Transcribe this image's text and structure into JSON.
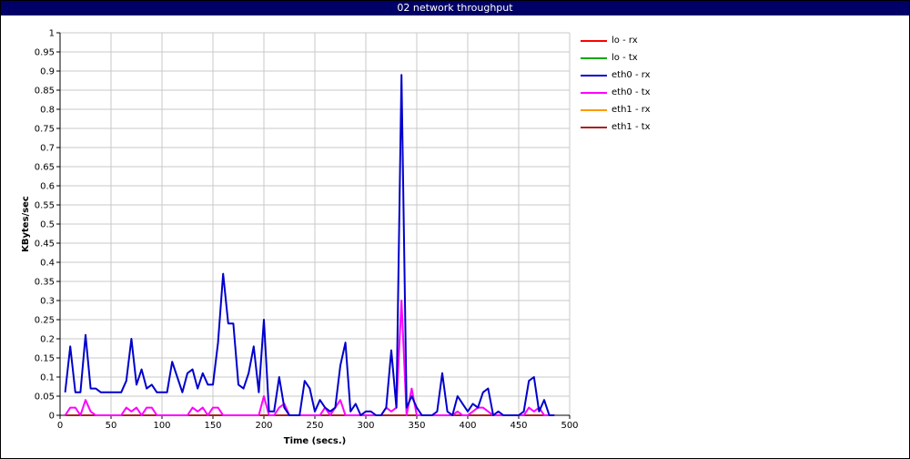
{
  "title": "02 network throughput",
  "chart_data": {
    "type": "line",
    "title": "02 network throughput",
    "xlabel": "Time (secs.)",
    "ylabel": "KBytes/sec",
    "xlim": [
      0,
      500
    ],
    "ylim": [
      0,
      1
    ],
    "xticks": [
      "0",
      "50",
      "100",
      "150",
      "200",
      "250",
      "300",
      "350",
      "400",
      "450",
      "500"
    ],
    "yticks": [
      "0",
      "0.05",
      "0.1",
      "0.15",
      "0.2",
      "0.25",
      "0.3",
      "0.35",
      "0.4",
      "0.45",
      "0.5",
      "0.55",
      "0.6",
      "0.65",
      "0.7",
      "0.75",
      "0.8",
      "0.85",
      "0.9",
      "0.95",
      "1"
    ],
    "grid": true,
    "legend_position": "right",
    "series": [
      {
        "name": "lo - rx",
        "color": "#ff0000",
        "x": [
          5,
          485
        ],
        "y": [
          0,
          0
        ]
      },
      {
        "name": "lo - tx",
        "color": "#00aa00",
        "x": [
          5,
          485
        ],
        "y": [
          0,
          0
        ]
      },
      {
        "name": "eth0 - rx",
        "color": "#0000cc",
        "x": [
          5,
          10,
          15,
          20,
          25,
          30,
          35,
          40,
          45,
          50,
          55,
          60,
          65,
          70,
          75,
          80,
          85,
          90,
          95,
          100,
          105,
          110,
          115,
          120,
          125,
          130,
          135,
          140,
          145,
          150,
          155,
          160,
          165,
          170,
          175,
          180,
          185,
          190,
          195,
          200,
          205,
          210,
          215,
          220,
          225,
          230,
          235,
          240,
          245,
          250,
          255,
          260,
          265,
          270,
          275,
          280,
          285,
          290,
          295,
          300,
          305,
          310,
          315,
          320,
          325,
          330,
          335,
          340,
          345,
          350,
          355,
          360,
          365,
          370,
          375,
          380,
          385,
          390,
          395,
          400,
          405,
          410,
          415,
          420,
          425,
          430,
          435,
          440,
          445,
          450,
          455,
          460,
          465,
          470,
          475,
          480,
          485
        ],
        "y": [
          0.06,
          0.18,
          0.06,
          0.06,
          0.21,
          0.07,
          0.07,
          0.06,
          0.06,
          0.06,
          0.06,
          0.06,
          0.09,
          0.2,
          0.08,
          0.12,
          0.07,
          0.08,
          0.06,
          0.06,
          0.06,
          0.14,
          0.1,
          0.06,
          0.11,
          0.12,
          0.07,
          0.11,
          0.08,
          0.08,
          0.19,
          0.37,
          0.24,
          0.24,
          0.08,
          0.07,
          0.11,
          0.18,
          0.06,
          0.25,
          0.01,
          0.01,
          0.1,
          0.02,
          0,
          0,
          0,
          0.09,
          0.07,
          0.01,
          0.04,
          0.02,
          0.01,
          0.02,
          0.13,
          0.19,
          0.01,
          0.03,
          0,
          0.01,
          0.01,
          0,
          0,
          0.02,
          0.17,
          0.02,
          0.89,
          0.02,
          0.05,
          0.02,
          0,
          0,
          0,
          0.01,
          0.11,
          0.01,
          0,
          0.05,
          0.03,
          0.01,
          0.03,
          0.02,
          0.06,
          0.07,
          0,
          0.01,
          0,
          0,
          0,
          0,
          0.01,
          0.09,
          0.1,
          0.01,
          0.04,
          0,
          0
        ]
      },
      {
        "name": "eth0 - tx",
        "color": "#ff00ff",
        "x": [
          5,
          10,
          15,
          20,
          25,
          30,
          35,
          40,
          45,
          50,
          55,
          60,
          65,
          70,
          75,
          80,
          85,
          90,
          95,
          100,
          105,
          110,
          115,
          120,
          125,
          130,
          135,
          140,
          145,
          150,
          155,
          160,
          165,
          170,
          175,
          180,
          185,
          190,
          195,
          200,
          205,
          210,
          215,
          220,
          225,
          230,
          235,
          240,
          245,
          250,
          255,
          260,
          265,
          270,
          275,
          280,
          285,
          290,
          295,
          300,
          305,
          310,
          315,
          320,
          325,
          330,
          335,
          340,
          345,
          350,
          355,
          360,
          365,
          370,
          375,
          380,
          385,
          390,
          395,
          400,
          405,
          410,
          415,
          420,
          425,
          430,
          435,
          440,
          445,
          450,
          455,
          460,
          465,
          470,
          475,
          480,
          485
        ],
        "y": [
          0,
          0.02,
          0.02,
          0,
          0.04,
          0.01,
          0,
          0,
          0,
          0,
          0,
          0,
          0.02,
          0.01,
          0.02,
          0,
          0.02,
          0.02,
          0,
          0,
          0,
          0,
          0,
          0,
          0,
          0.02,
          0.01,
          0.02,
          0,
          0.02,
          0.02,
          0,
          0,
          0,
          0,
          0,
          0,
          0,
          0,
          0.05,
          0,
          0,
          0.02,
          0.03,
          0,
          0,
          0,
          0,
          0,
          0,
          0,
          0.02,
          0,
          0.02,
          0.04,
          0,
          0,
          0,
          0,
          0,
          0,
          0,
          0,
          0.02,
          0.01,
          0.02,
          0.3,
          0,
          0.07,
          0,
          0,
          0,
          0,
          0,
          0,
          0,
          0,
          0.01,
          0,
          0,
          0.01,
          0.02,
          0.02,
          0.01,
          0,
          0,
          0,
          0,
          0,
          0,
          0,
          0.02,
          0.01,
          0.02,
          0,
          0,
          0
        ]
      },
      {
        "name": "eth1 - rx",
        "color": "#ff9900",
        "x": [
          5,
          485
        ],
        "y": [
          0,
          0
        ]
      },
      {
        "name": "eth1 - tx",
        "color": "#aa2222",
        "x": [
          5,
          485
        ],
        "y": [
          0,
          0
        ]
      }
    ]
  }
}
